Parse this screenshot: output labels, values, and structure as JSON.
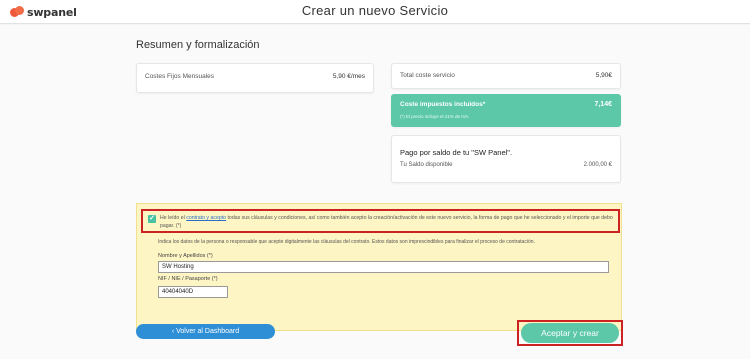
{
  "header": {
    "logo_text": "swpanel",
    "page_title": "Crear un nuevo Servicio"
  },
  "summary": {
    "section_title": "Resumen y formalización",
    "fixed_costs_label": "Costes Fijos Mensuales",
    "fixed_costs_value": "5,90 €/mes",
    "total_cost_label": "Total coste servicio",
    "total_cost_value": "5,90€",
    "tax_label": "Coste impuestos incluidos*",
    "tax_value": "7,14€",
    "tax_note": "(*) El precio incluye el 21% de IVA.",
    "payment_title": "Pago por saldo de tu \"SW Panel\".",
    "balance_label": "Tu Saldo disponible",
    "balance_value": "2.000,00 €"
  },
  "terms": {
    "text_before_link": "He leído el ",
    "link_text": "contrato y acepto",
    "text_after_link": " todas sus cláusulas y condiciones, así como también acepto la creación/activación de este nuevo servicio, la forma de pago que he seleccionado y el importe que debo pagar.  (*)",
    "checked": true,
    "info_text": "Indica los datos de la persona o responsable que acepte digitalmente las cláusulas del contrato. Estos datos son imprescindibles para finalizar el proceso de contratación.",
    "name_label": "Nombre y Apellidos (*)",
    "name_value": "SW Hosting",
    "nif_label": "NIF / NIE / Pasaporte (*)",
    "nif_value": "40404040D"
  },
  "actions": {
    "back_label": "‹  Volver al Dashboard",
    "accept_label": "Aceptar y crear"
  },
  "colors": {
    "accent_green": "#5cc8a8",
    "accent_blue": "#2e8fd6",
    "highlight_red": "#cc2222",
    "terms_bg": "#fdf5c3"
  }
}
